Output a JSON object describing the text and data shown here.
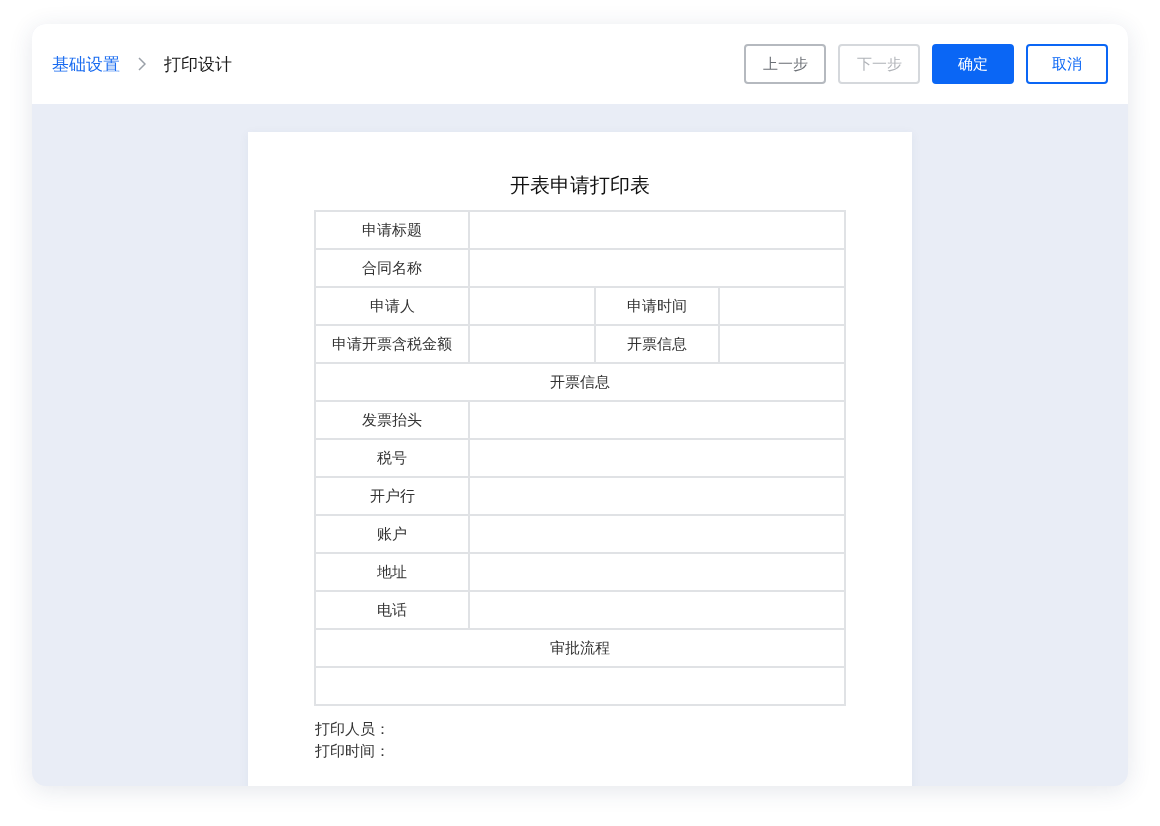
{
  "breadcrumb": [
    {
      "label": "基础设置",
      "current": false
    },
    {
      "label": "打印设计",
      "current": true
    }
  ],
  "buttons": [
    {
      "label": "上一步",
      "kind": "default",
      "disabled": false
    },
    {
      "label": "下一步",
      "kind": "default",
      "disabled": true
    },
    {
      "label": "确定",
      "kind": "primary",
      "disabled": false
    },
    {
      "label": "取消",
      "kind": "outline",
      "disabled": false
    }
  ],
  "document": {
    "title": "开表申请打印表",
    "rows": [
      {
        "kind": "pair",
        "label": "申请标题"
      },
      {
        "kind": "pair",
        "label": "合同名称"
      },
      {
        "kind": "quad",
        "labels": [
          "申请人",
          "申请时间"
        ]
      },
      {
        "kind": "quad",
        "labels": [
          "申请开票含税金额",
          "开票信息"
        ]
      },
      {
        "kind": "section",
        "label": "开票信息"
      },
      {
        "kind": "pair",
        "label": "发票抬头"
      },
      {
        "kind": "pair",
        "label": "税号"
      },
      {
        "kind": "pair",
        "label": "开户行"
      },
      {
        "kind": "pair",
        "label": "账户"
      },
      {
        "kind": "pair",
        "label": "地址"
      },
      {
        "kind": "pair",
        "label": "电话"
      },
      {
        "kind": "section",
        "label": "审批流程"
      },
      {
        "kind": "blank"
      }
    ],
    "footer": [
      "打印人员：",
      "打印时间："
    ]
  }
}
